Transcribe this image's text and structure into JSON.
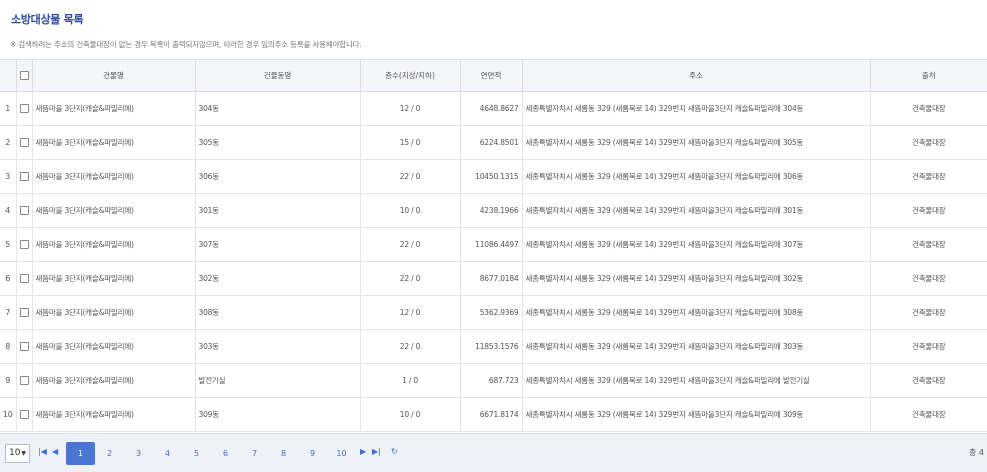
{
  "page": {
    "title": "소방대상물 목록",
    "notice": "※ 검색하려는 주소의 건축물대장이 없는 경우 목록이 출력되지않으며, 이러한 경우 임의주소 등록을 사용해야합니다."
  },
  "table": {
    "headers": [
      "건물명",
      "건물동명",
      "층수(지상/지하)",
      "연면적",
      "주소",
      "출처"
    ],
    "rows": [
      {
        "no": "1",
        "name": "새뜸마을 3단지(캐슬&파밀리에)",
        "dong": "304동",
        "floors": "12 / 0",
        "area": "4648.8627",
        "address": "세종특별자치시 새롬동 329 (새롬북로 14) 329번지 새뜸마을3단지 캐슬&파밀리에 304동",
        "source": "건축물대장"
      },
      {
        "no": "2",
        "name": "새뜸마을 3단지(캐슬&파밀리에)",
        "dong": "305동",
        "floors": "15 / 0",
        "area": "6224.8501",
        "address": "세종특별자치시 새롬동 329 (새롬북로 14) 329번지 새뜸마을3단지 캐슬&파밀리에 305동",
        "source": "건축물대장"
      },
      {
        "no": "3",
        "name": "새뜸마을 3단지(캐슬&파밀리에)",
        "dong": "306동",
        "floors": "22 / 0",
        "area": "10450.1315",
        "address": "세종특별자치시 새롬동 329 (새롬북로 14) 329번지 새뜸마을3단지 캐슬&파밀리에 306동",
        "source": "건축물대장"
      },
      {
        "no": "4",
        "name": "새뜸마을 3단지(캐슬&파밀리에)",
        "dong": "301동",
        "floors": "10 / 0",
        "area": "4238.1966",
        "address": "세종특별자치시 새롬동 329 (새롬북로 14) 329번지 새뜸마을3단지 캐슬&파밀리에 301동",
        "source": "건축물대장"
      },
      {
        "no": "5",
        "name": "새뜸마을 3단지(캐슬&파밀리에)",
        "dong": "307동",
        "floors": "22 / 0",
        "area": "11086.4497",
        "address": "세종특별자치시 새롬동 329 (새롬북로 14) 329번지 새뜸마을3단지 캐슬&파밀리에 307동",
        "source": "건축물대장"
      },
      {
        "no": "6",
        "name": "새뜸마을 3단지(캐슬&파밀리에)",
        "dong": "302동",
        "floors": "22 / 0",
        "area": "8677.0184",
        "address": "세종특별자치시 새롬동 329 (새롬북로 14) 329번지 새뜸마을3단지 캐슬&파밀리에 302동",
        "source": "건축물대장"
      },
      {
        "no": "7",
        "name": "새뜸마을 3단지(캐슬&파밀리에)",
        "dong": "308동",
        "floors": "12 / 0",
        "area": "5362.9369",
        "address": "세종특별자치시 새롬동 329 (새롬북로 14) 329번지 새뜸마을3단지 캐슬&파밀리에 308동",
        "source": "건축물대장"
      },
      {
        "no": "8",
        "name": "새뜸마을 3단지(캐슬&파밀리에)",
        "dong": "303동",
        "floors": "22 / 0",
        "area": "11853.1576",
        "address": "세종특별자치시 새롬동 329 (새롬북로 14) 329번지 새뜸마을3단지 캐슬&파밀리에 303동",
        "source": "건축물대장"
      },
      {
        "no": "9",
        "name": "새뜸마을 3단지(캐슬&파밀리에)",
        "dong": "발전기실",
        "floors": "1 / 0",
        "area": "687.723",
        "address": "세종특별자치시 새롬동 329 (새롬북로 14) 329번지 새뜸마을3단지 캐슬&파밀리에 발전기실",
        "source": "건축물대장"
      },
      {
        "no": "10",
        "name": "새뜸마을 3단지(캐슬&파밀리에)",
        "dong": "309동",
        "floors": "10 / 0",
        "area": "6671.8174",
        "address": "세종특별자치시 새롬동 329 (새롬북로 14) 329번지 새뜸마을3단지 캐슬&파밀리에 309동",
        "source": "건축물대장"
      }
    ]
  },
  "pager": {
    "page_size": "10",
    "pages": [
      "1",
      "2",
      "3",
      "4",
      "5",
      "6",
      "7",
      "8",
      "9",
      "10"
    ],
    "active_page": "1",
    "total": "총 4"
  },
  "colors": {
    "title": "#2f4d9c",
    "active_page_bg": "#4a77d4",
    "pager_bg": "#eef1f7",
    "header_bg": "#f3f5f9"
  }
}
